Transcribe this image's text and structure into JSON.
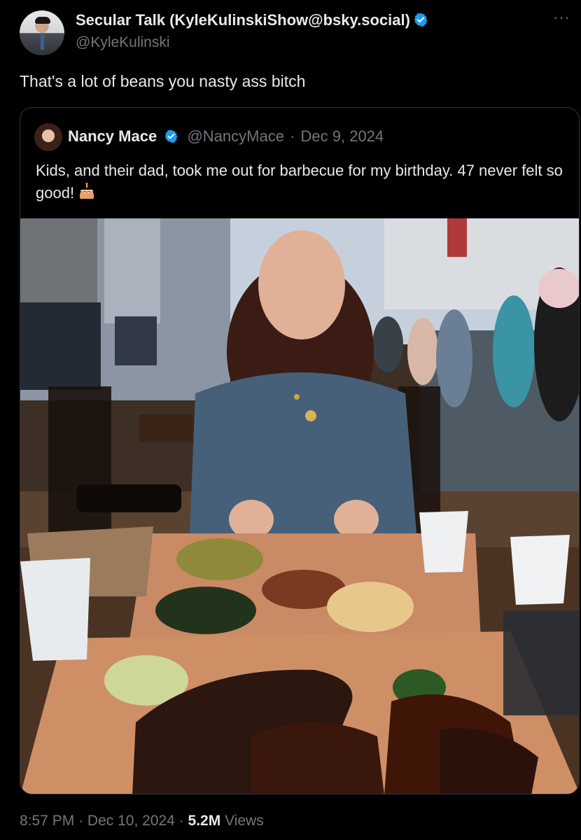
{
  "author": {
    "display_name": "Secular Talk (KyleKulinskiShow@bsky.social)",
    "handle": "@KyleKulinski",
    "verified_color": "#1d9bf0"
  },
  "more_menu": "···",
  "tweet": {
    "text": "That's a lot of beans you nasty ass bitch"
  },
  "quoted": {
    "display_name": "Nancy Mace",
    "handle": "@NancyMace",
    "separator": "·",
    "date": "Dec 9, 2024",
    "text": "Kids, and their dad, took me out for barbecue for my birthday. 47 never felt so good!",
    "emoji": "birthday-cake-icon"
  },
  "footer": {
    "time": "8:57 PM",
    "separator": "·",
    "date": "Dec 10, 2024",
    "views_count": "5.2M",
    "views_label": "Views"
  }
}
